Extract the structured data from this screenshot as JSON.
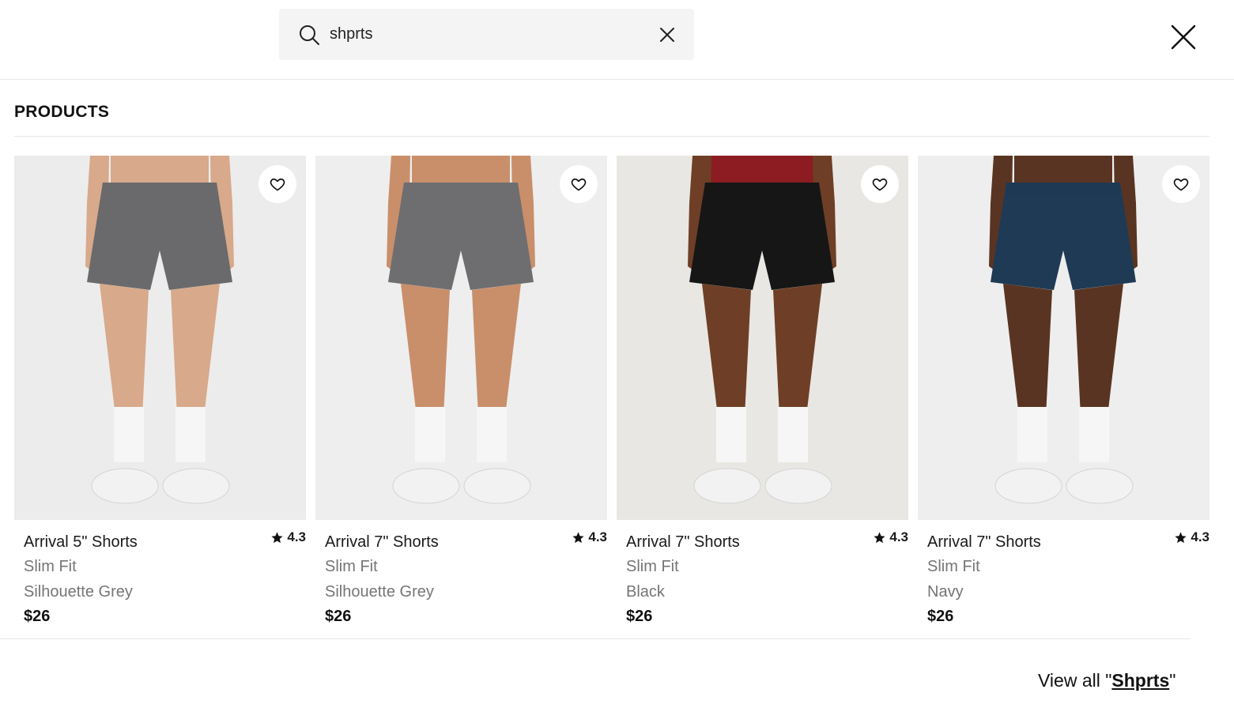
{
  "search": {
    "value": "shprts",
    "clear_icon": "close-icon",
    "search_icon": "search-icon"
  },
  "header": {
    "close_icon": "close-icon"
  },
  "products_section": {
    "title": "PRODUCTS"
  },
  "products": [
    {
      "name": "Arrival 5\" Shorts",
      "rating": "4.3",
      "fit": "Slim Fit",
      "color": "Silhouette Grey",
      "price": "$26",
      "short_color": "#6a6a6c",
      "skin_color": "#d8a98a",
      "top_color": "",
      "bg_color": "#ececec"
    },
    {
      "name": "Arrival 7\" Shorts",
      "rating": "4.3",
      "fit": "Slim Fit",
      "color": "Silhouette Grey",
      "price": "$26",
      "short_color": "#6e6e70",
      "skin_color": "#c98f6a",
      "top_color": "",
      "bg_color": "#eeeeee"
    },
    {
      "name": "Arrival 7\" Shorts",
      "rating": "4.3",
      "fit": "Slim Fit",
      "color": "Black",
      "price": "$26",
      "short_color": "#161616",
      "skin_color": "#6e3f26",
      "top_color": "#8d1b22",
      "bg_color": "#e9e7e3"
    },
    {
      "name": "Arrival 7\" Shorts",
      "rating": "4.3",
      "fit": "Slim Fit",
      "color": "Navy",
      "price": "$26",
      "short_color": "#1f3a55",
      "skin_color": "#5a3422",
      "top_color": "",
      "bg_color": "#eeeeee"
    }
  ],
  "footer": {
    "view_all_prefix": "View all \"",
    "view_all_term": "Shprts",
    "view_all_suffix": "\""
  }
}
